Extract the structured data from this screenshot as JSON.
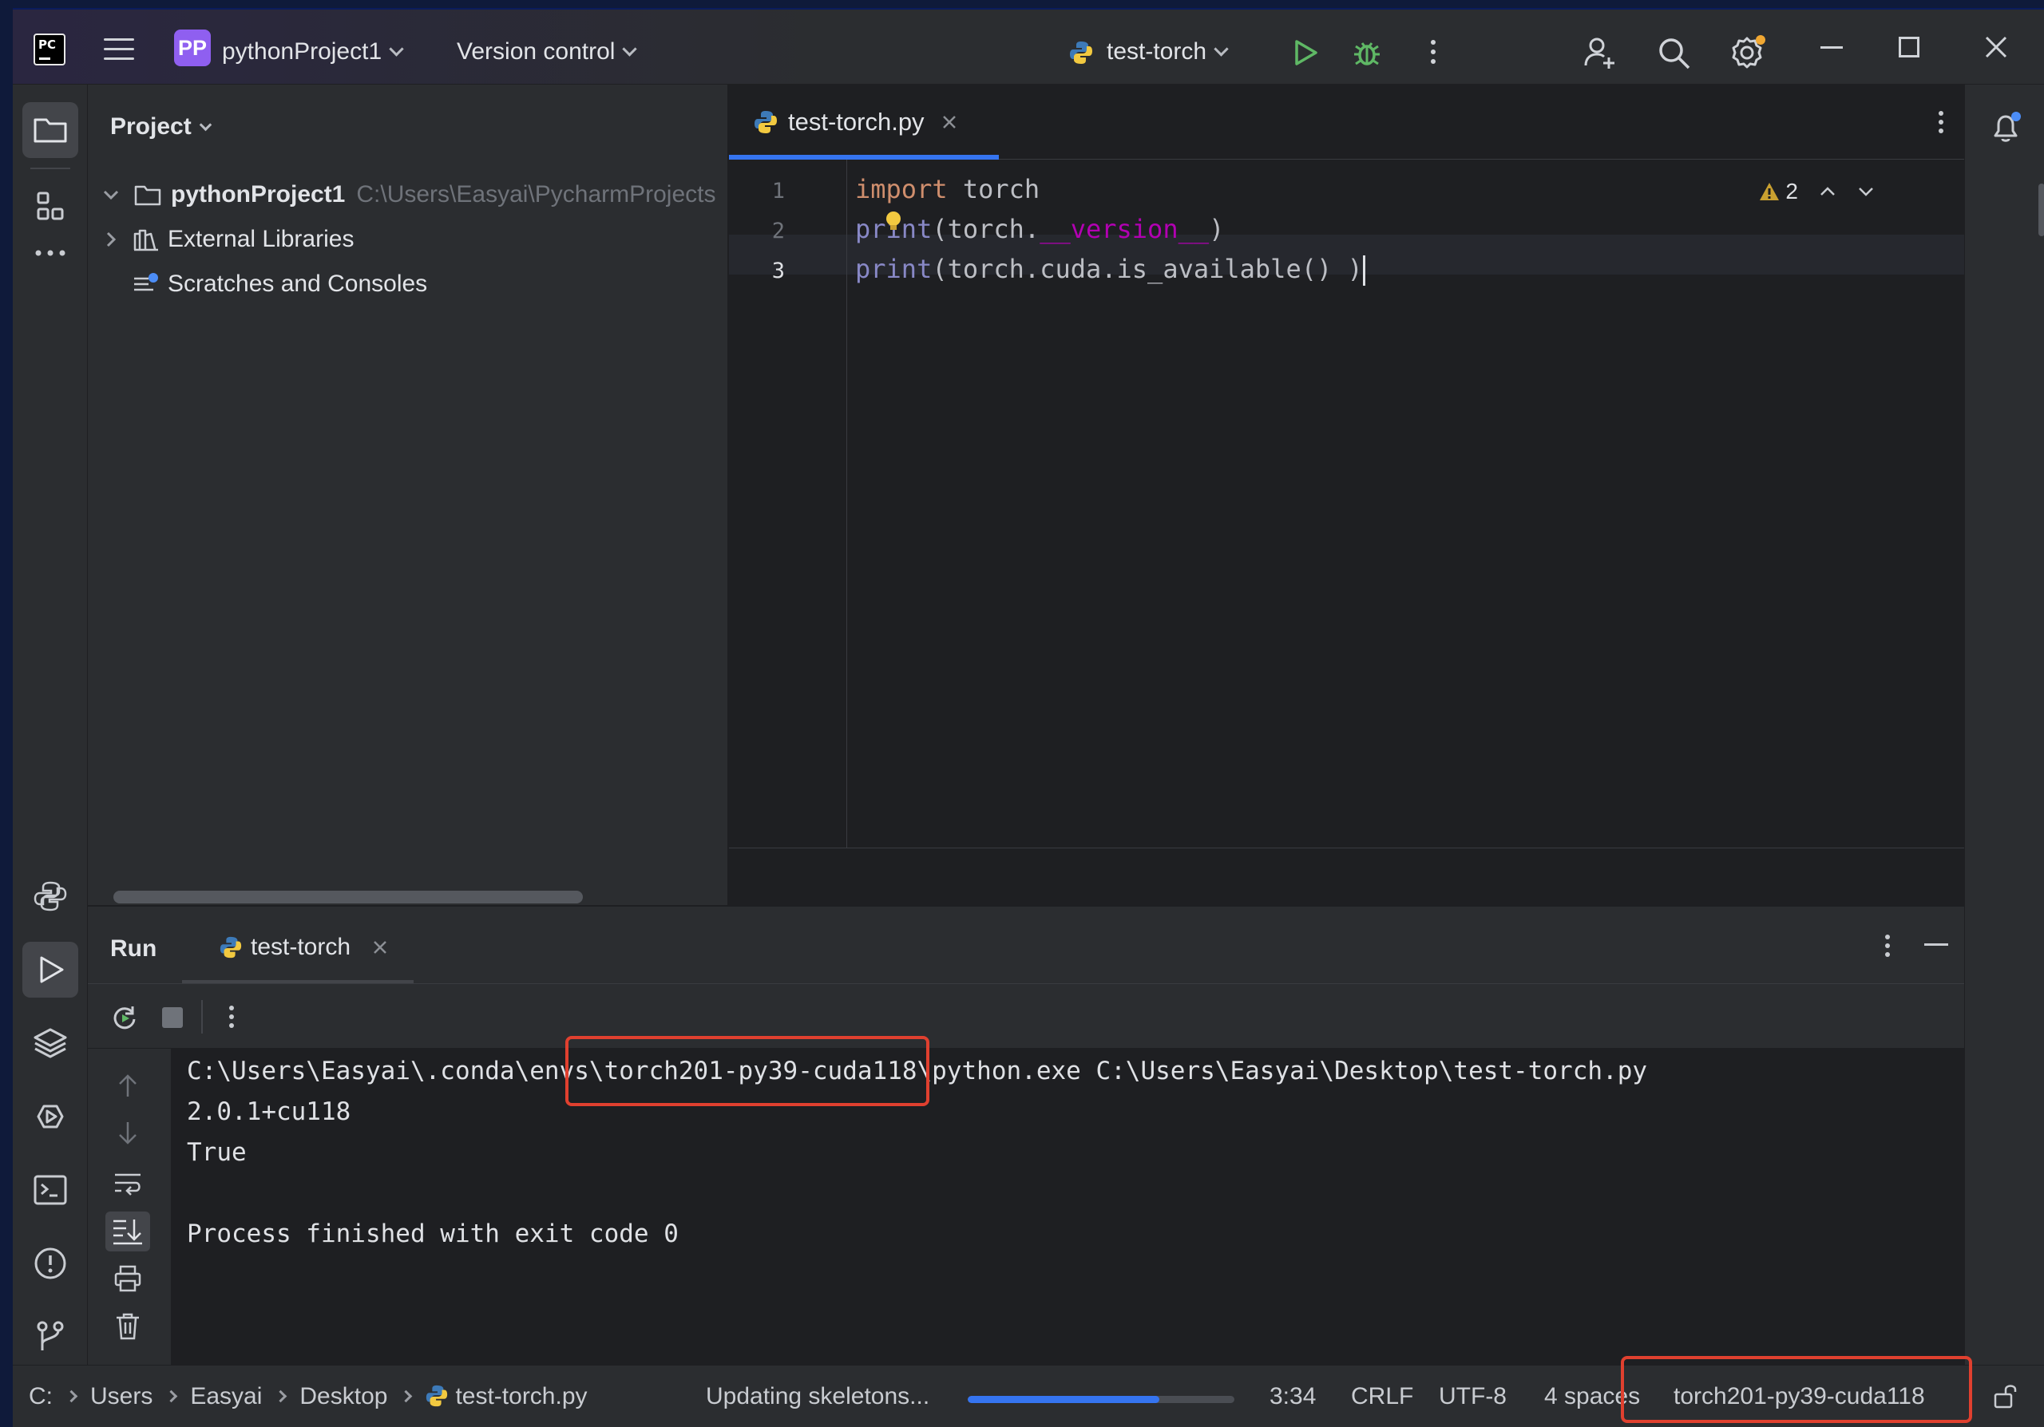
{
  "titlebar": {
    "project_badge": "PP",
    "project_name": "pythonProject1",
    "version_control": "Version control",
    "run_config": "test-torch"
  },
  "project_panel": {
    "title": "Project",
    "tree": [
      {
        "label": "pythonProject1",
        "path": "C:\\Users\\Easyai\\PycharmProjects"
      },
      {
        "label": "External Libraries"
      },
      {
        "label": "Scratches and Consoles"
      }
    ]
  },
  "editor": {
    "tab_label": "test-torch.py",
    "warning_count": "2",
    "lines": [
      {
        "num": "1",
        "tokens": [
          {
            "t": "import",
            "c": "kw"
          },
          {
            "t": " torch",
            "c": ""
          }
        ]
      },
      {
        "num": "2",
        "tokens": [
          {
            "t": "print",
            "c": "fn"
          },
          {
            "t": "(torch.",
            "c": ""
          },
          {
            "t": "__version__",
            "c": "dunder"
          },
          {
            "t": ")",
            "c": ""
          }
        ]
      },
      {
        "num": "3",
        "tokens": [
          {
            "t": "print",
            "c": "fn"
          },
          {
            "t": "(torch.cuda.is_available() )",
            "c": ""
          }
        ]
      }
    ]
  },
  "run_panel": {
    "label": "Run",
    "tab_label": "test-torch",
    "console": [
      "C:\\Users\\Easyai\\.conda\\envs\\torch201-py39-cuda118\\python.exe C:\\Users\\Easyai\\Desktop\\test-torch.py",
      "2.0.1+cu118",
      "True",
      "",
      "Process finished with exit code 0"
    ]
  },
  "statusbar": {
    "breadcrumb": [
      "C:",
      "Users",
      "Easyai",
      "Desktop",
      "test-torch.py"
    ],
    "task": "Updating skeletons...",
    "progress": 0.72,
    "position": "3:34",
    "line_sep": "CRLF",
    "encoding": "UTF-8",
    "indent": "4 spaces",
    "interpreter": "torch201-py39-cuda118"
  },
  "colors": {
    "accent": "#3574f0",
    "highlight_box": "#e0402f",
    "project_badge": "#8f5ff0",
    "run_green": "#5fb865"
  }
}
